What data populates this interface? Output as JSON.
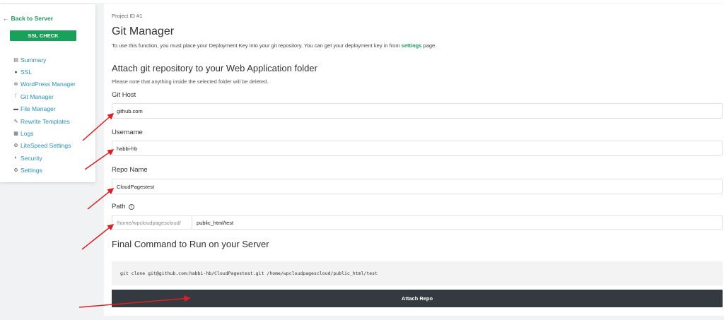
{
  "sidebar": {
    "back_label": "Back to Server",
    "ssl_check_label": "SSL CHECK",
    "items": [
      {
        "label": "Summary",
        "icon": "summary-icon"
      },
      {
        "label": "SSL",
        "icon": "ssl-icon"
      },
      {
        "label": "WordPress Manager",
        "icon": "wordpress-icon"
      },
      {
        "label": "Git Manager",
        "icon": "git-icon"
      },
      {
        "label": "File Manager",
        "icon": "folder-icon"
      },
      {
        "label": "Rewrite Templates",
        "icon": "rewrite-icon"
      },
      {
        "label": "Logs",
        "icon": "logs-icon"
      },
      {
        "label": "LiteSpeed Settings",
        "icon": "gear-icon"
      },
      {
        "label": "Security",
        "icon": "shield-icon"
      },
      {
        "label": "Settings",
        "icon": "gear-icon"
      }
    ]
  },
  "main": {
    "project_id": "Project ID #1",
    "title": "Git Manager",
    "description_prefix": "To use this function, you must place your Deployment Key into your git repository. You can get your deployment key in from ",
    "description_link": "settings",
    "description_suffix": " page.",
    "attach_title": "Attach git repository to your Web Application folder",
    "attach_note": "Please note that anything inside the selected folder will be deleted.",
    "git_host_label": "Git Host",
    "git_host_value": "github.com",
    "username_label": "Username",
    "username_value": "habbi-hb",
    "repo_label": "Repo Name",
    "repo_value": "CloudPagestest",
    "path_label": "Path",
    "path_prefix": "/home/wpcloudpagescloud/",
    "path_value": "public_html/test",
    "command_title": "Final Command to Run on your Server",
    "command": "git clone git@github.com:habbi-hb/CloudPagestest.git /home/wpcloudpagescloud/public_html/test",
    "attach_button": "Attach Repo"
  },
  "colors": {
    "accent_green": "#19a05a",
    "link_blue": "#2a8fbf",
    "button_dark": "#343a40",
    "arrow_red": "#e02020"
  }
}
